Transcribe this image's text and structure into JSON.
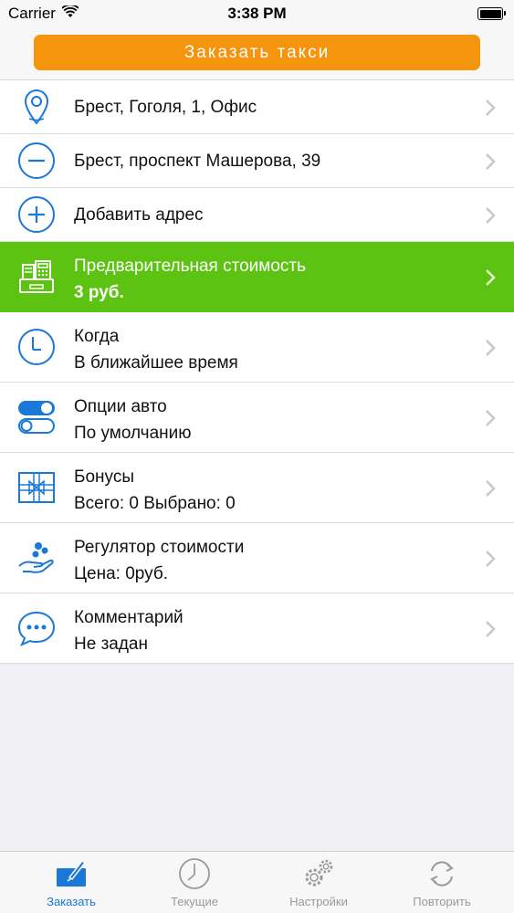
{
  "status_bar": {
    "carrier": "Carrier",
    "time": "3:38 PM"
  },
  "order_button": {
    "label": "Заказать такси",
    "color": "#f5940d"
  },
  "rows": [
    {
      "icon": "location-pin-icon",
      "title": "Брест, Гоголя, 1, Офис"
    },
    {
      "icon": "minus-circle-icon",
      "title": "Брест, проспект Машерова, 39"
    },
    {
      "icon": "plus-circle-icon",
      "title": "Добавить адрес"
    },
    {
      "icon": "cash-register-icon",
      "title": "Предварительная стоимость",
      "subtitle": "3 руб.",
      "highlight_color": "#5cc312"
    },
    {
      "icon": "clock-icon",
      "title": "Когда",
      "subtitle": "В ближайшее время"
    },
    {
      "icon": "toggle-switches-icon",
      "title": "Опции авто",
      "subtitle": "По умолчанию"
    },
    {
      "icon": "gift-icon",
      "title": "Бонусы",
      "subtitle": "Всего: 0 Выбрано: 0"
    },
    {
      "icon": "hand-coins-icon",
      "title": "Регулятор стоимости",
      "subtitle": "Цена: 0руб."
    },
    {
      "icon": "chat-bubble-icon",
      "title": "Комментарий",
      "subtitle": "Не задан"
    }
  ],
  "tabbar": {
    "items": [
      {
        "label": "Заказать",
        "icon": "order-icon",
        "active": true
      },
      {
        "label": "Текущие",
        "icon": "clock-icon",
        "active": false
      },
      {
        "label": "Настройки",
        "icon": "gears-icon",
        "active": false
      },
      {
        "label": "Повторить",
        "icon": "repeat-icon",
        "active": false
      }
    ],
    "active_color": "#1a78d6",
    "inactive_color": "#9a9a9a"
  },
  "accent_color": "#1a78d6"
}
